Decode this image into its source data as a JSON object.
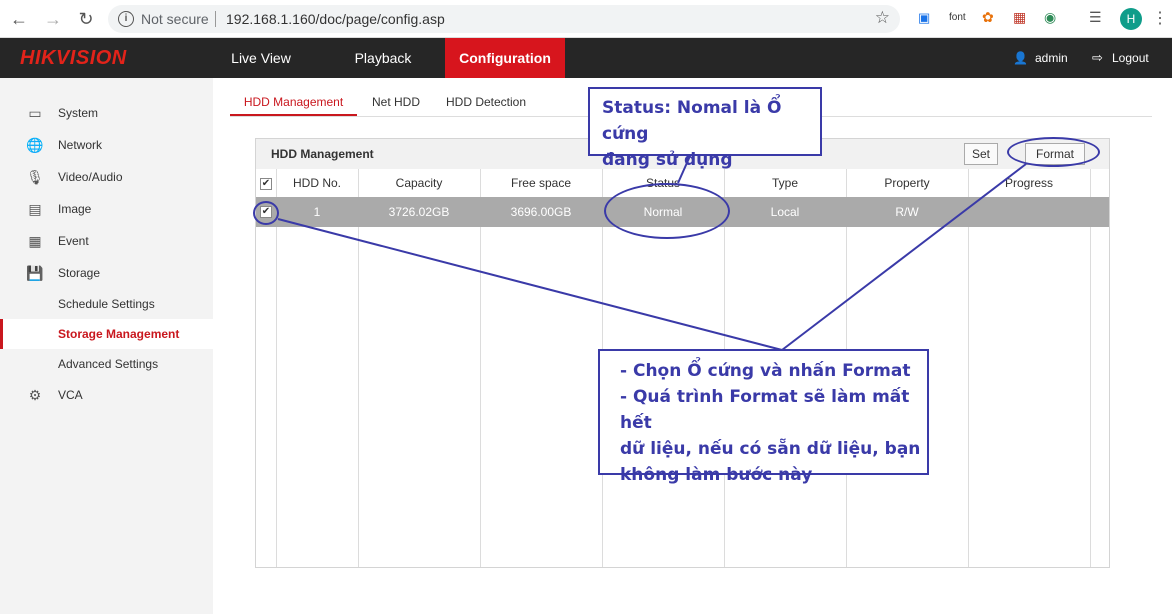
{
  "browser": {
    "not_secure": "Not secure",
    "url": "192.168.1.160/doc/page/config.asp",
    "ext_font": "font",
    "profile_initial": "H"
  },
  "header": {
    "logo_hik": "HIK",
    "logo_vision": "VISION",
    "tabs": [
      "Live View",
      "Playback",
      "Configuration"
    ],
    "active_tab": "Configuration",
    "user": "admin",
    "logout": "Logout",
    "accent": "#d7151d"
  },
  "sidebar": {
    "items": [
      {
        "label": "System",
        "icon": "monitor-icon"
      },
      {
        "label": "Network",
        "icon": "globe-icon"
      },
      {
        "label": "Video/Audio",
        "icon": "microphone-camera-icon"
      },
      {
        "label": "Image",
        "icon": "image-icon"
      },
      {
        "label": "Event",
        "icon": "calendar-icon"
      },
      {
        "label": "Storage",
        "icon": "floppy-disk-icon"
      },
      {
        "label": "Schedule Settings",
        "icon": ""
      },
      {
        "label": "Storage Management",
        "icon": ""
      },
      {
        "label": "Advanced Settings",
        "icon": ""
      },
      {
        "label": "VCA",
        "icon": "vca-icon"
      }
    ],
    "active": "Storage Management"
  },
  "sub_tabs": [
    "HDD Management",
    "Net HDD",
    "HDD Detection"
  ],
  "panel": {
    "title": "HDD Management",
    "set_label": "Set",
    "format_label": "Format",
    "columns": [
      "HDD No.",
      "Capacity",
      "Free space",
      "Status",
      "Type",
      "Property",
      "Progress"
    ],
    "rows": [
      {
        "hdd_no": "1",
        "capacity": "3726.02GB",
        "free_space": "3696.00GB",
        "status": "Normal",
        "type": "Local",
        "property": "R/W",
        "progress": "",
        "checked": true
      }
    ]
  },
  "annotations": {
    "status_note_line1": "Status: Nomal là Ổ cứng",
    "status_note_line2": "đang sử dụng",
    "format_note": [
      "- Chọn Ổ cứng và nhấn Format",
      "- Quá trình Format sẽ làm mất hết",
      "dữ liệu, nếu có sẵn dữ liệu, bạn",
      "không làm bước này"
    ],
    "color": "#3a3aa8"
  }
}
